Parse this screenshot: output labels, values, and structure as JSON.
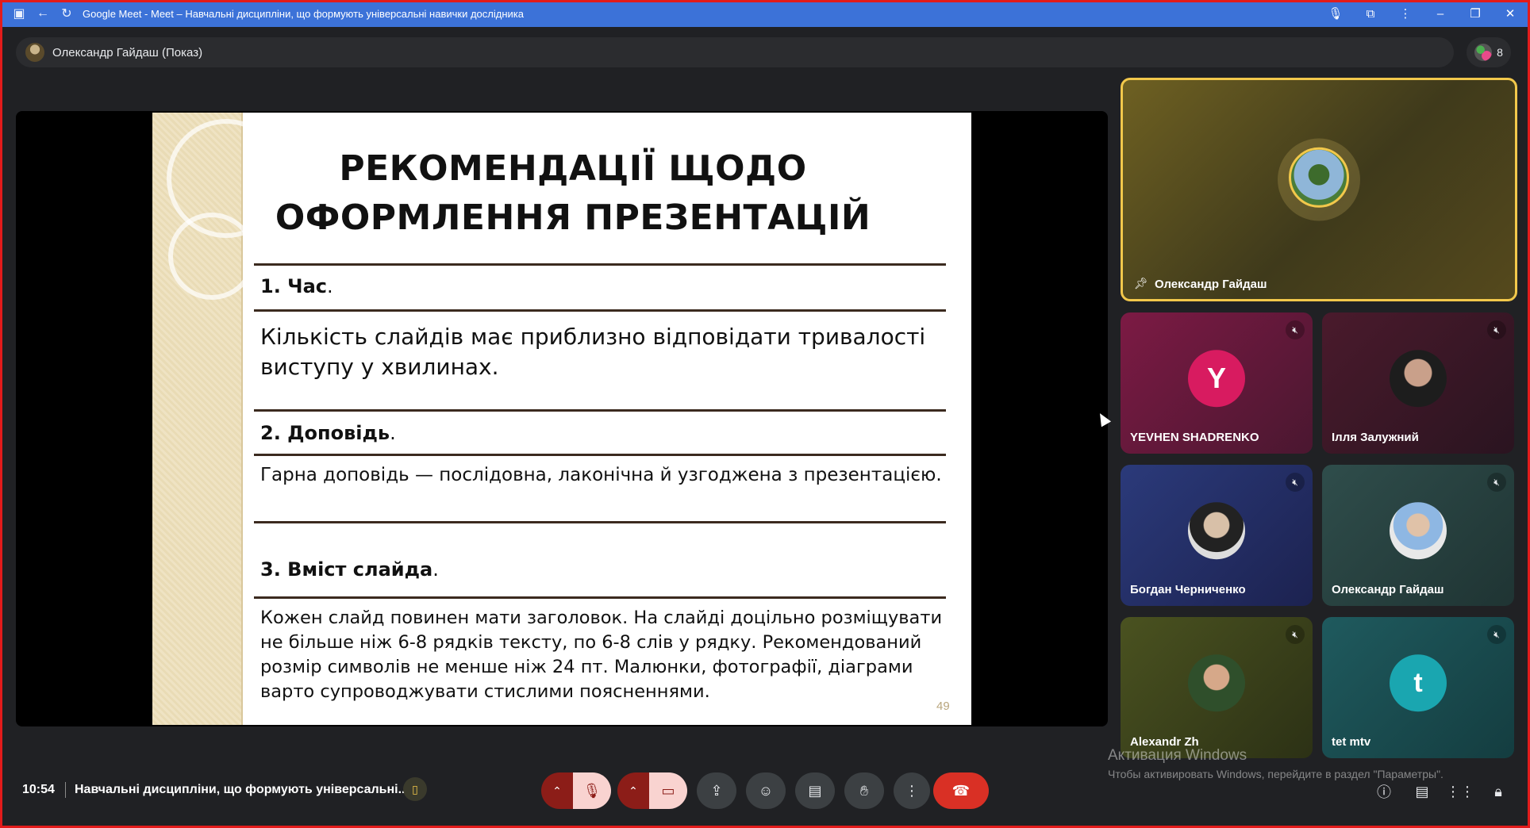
{
  "browser": {
    "title": "Google Meet - Meet – Навчальні дисципліни, що формують універсальні навички дослідника",
    "icons": [
      "meet-favicon",
      "back-arrow",
      "reload"
    ],
    "right_icons": [
      "microphone",
      "extensions",
      "more",
      "minimize",
      "restore",
      "close"
    ]
  },
  "presenter": {
    "label": "Олександр Гайдаш (Показ)"
  },
  "participants_count": "8",
  "slide": {
    "title_line1": "РЕКОМЕНДАЦІЇ ЩОДО",
    "title_line2": "ОФОРМЛЕННЯ ПРЕЗЕНТАЦІЙ",
    "section1_heading": "1. Час",
    "section1_body": "Кількість слайдів має приблизно відповідати тривалості виступу у хвилинах.",
    "section2_heading": "2. Доповідь",
    "section2_body": "Гарна доповідь — послідовна, лаконічна й узгоджена з презентацією.",
    "section3_heading": "3. Вміст слайда",
    "section3_body": "Кожен слайд повинен мати заголовок.  На слайді доцільно розміщувати не більше ніж 6-8 рядків тексту, по 6-8 слів у рядку. Рекомендований розмір символів не менше ніж 24 пт. Малюнки, фотографії, діаграми варто супроводжувати стислими поясненнями.",
    "dot": ".",
    "page_number": "49"
  },
  "tiles": {
    "pinned": {
      "name": "Олександр Гайдаш"
    },
    "t1": {
      "name": "YEVHEN SHADRENKO",
      "initial": "Y"
    },
    "t2": {
      "name": "Ілля Залужний"
    },
    "t3": {
      "name": "Богдан Черниченко"
    },
    "t4": {
      "name": "Олександр Гайдаш"
    },
    "t5": {
      "name": "Alexandr Zh"
    },
    "t6": {
      "name": "tet mtv",
      "initial": "t"
    }
  },
  "bottom": {
    "time": "10:54",
    "meeting_title": "Навчальні дисципліни, що формують універсальні..."
  },
  "windows_activation": {
    "line1": "Активация Windows",
    "line2": "Чтобы активировать Windows, перейдите в раздел \"Параметры\"."
  },
  "colors": {
    "accent_yellow": "#f2c84b",
    "end_call_red": "#d93025",
    "muted_red": "#8c1d18",
    "title_bar_blue": "#3c72d8"
  }
}
